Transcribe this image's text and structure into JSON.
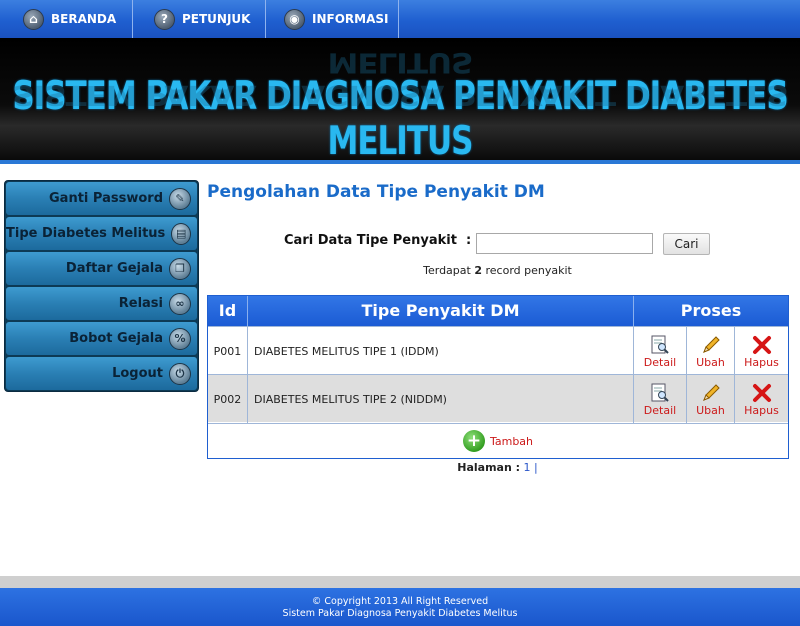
{
  "nav": {
    "items": [
      {
        "label": "BERANDA",
        "icon": "home-icon"
      },
      {
        "label": "PETUNJUK",
        "icon": "help-icon"
      },
      {
        "label": "INFORMASI",
        "icon": "info-icon"
      }
    ]
  },
  "banner": {
    "title": "SISTEM PAKAR DIAGNOSA PENYAKIT DIABETES MELITUS"
  },
  "sidebar": {
    "items": [
      {
        "label": "Ganti Password",
        "icon": "key-icon"
      },
      {
        "label": "Tipe Diabetes Melitus",
        "icon": "database-icon"
      },
      {
        "label": "Daftar Gejala",
        "icon": "list-icon"
      },
      {
        "label": "Relasi",
        "icon": "link-icon"
      },
      {
        "label": "Bobot Gejala",
        "icon": "percent-icon"
      },
      {
        "label": "Logout",
        "icon": "power-icon"
      }
    ]
  },
  "main": {
    "title": "Pengolahan Data Tipe Penyakit DM",
    "search": {
      "label": "Cari Data Tipe Penyakit",
      "separator": ":",
      "value": "",
      "button": "Cari"
    },
    "record_info": {
      "prefix": "Terdapat",
      "count": "2",
      "suffix": "record penyakit"
    },
    "table": {
      "headers": [
        "Id",
        "Tipe Penyakit DM",
        "Proses"
      ],
      "rows": [
        {
          "id": "P001",
          "name": "DIABETES MELITUS TIPE 1 (IDDM)"
        },
        {
          "id": "P002",
          "name": "DIABETES MELITUS TIPE 2 (NIDDM)"
        }
      ],
      "actions": {
        "detail": "Detail",
        "edit": "Ubah",
        "delete": "Hapus"
      },
      "add_label": "Tambah"
    },
    "pager": {
      "label": "Halaman :",
      "current": "1",
      "sep": "|"
    }
  },
  "footer": {
    "line1": "© Copyright 2013 All Right Reserved",
    "line2": "Sistem Pakar Diagnosa Penyakit Diabetes Melitus"
  },
  "colors": {
    "nav_blue": "#1f5fd0",
    "title_blue": "#1a6bc9",
    "banner_text": "#29b8f0",
    "action_red": "#cc1a1a",
    "row_alt": "#dedede"
  }
}
